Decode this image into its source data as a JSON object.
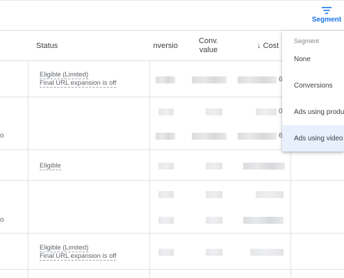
{
  "toolbar": {
    "segment_label": "Segment",
    "segment_icon": "filter-list-icon",
    "accent_color": "#1a73e8"
  },
  "table": {
    "headers": {
      "status": "Status",
      "conversions": "nversio",
      "conv_value": "Conv.\nvalue",
      "cost": "↓ Cost"
    },
    "rows": [
      {
        "status": [
          "Eligible (Limited)",
          "Final URL expansion is off"
        ],
        "cost_tail": "6"
      },
      {
        "status": [],
        "cost_tail": "0"
      },
      {
        "status": [],
        "cost_tail": "6"
      },
      {
        "status": [
          "Eligible"
        ],
        "cost_tail": ""
      },
      {
        "status": [],
        "cost_tail": ""
      },
      {
        "status": [],
        "cost_tail": ""
      },
      {
        "status": [
          "Eligible (Limited)",
          "Final URL expansion is off"
        ],
        "cost_tail": ""
      }
    ],
    "left_edge_marks": [
      "o",
      "o"
    ]
  },
  "segment_menu": {
    "heading": "Segment",
    "items": [
      "None",
      "Conversions",
      "Ads using produc",
      "Ads using video"
    ],
    "selected_index": 3
  }
}
